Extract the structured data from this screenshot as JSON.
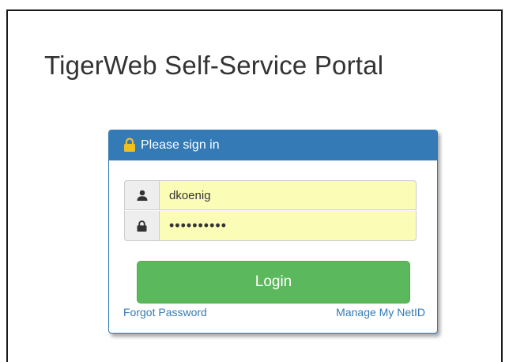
{
  "page": {
    "title": "TigerWeb Self-Service Portal"
  },
  "login_panel": {
    "heading": "Please sign in",
    "username": {
      "value": "dkoenig",
      "icon": "user-icon"
    },
    "password": {
      "value": "••••••••••",
      "icon": "lock-icon"
    },
    "login_label": "Login",
    "forgot_password_label": "Forgot Password",
    "manage_netid_label": "Manage My NetID"
  },
  "colors": {
    "panel_heading": "#337ab7",
    "lock_icon": "#f0c020",
    "login_button": "#5cb85c",
    "autofill_field": "#fbfdb6",
    "link": "#337ab7"
  }
}
